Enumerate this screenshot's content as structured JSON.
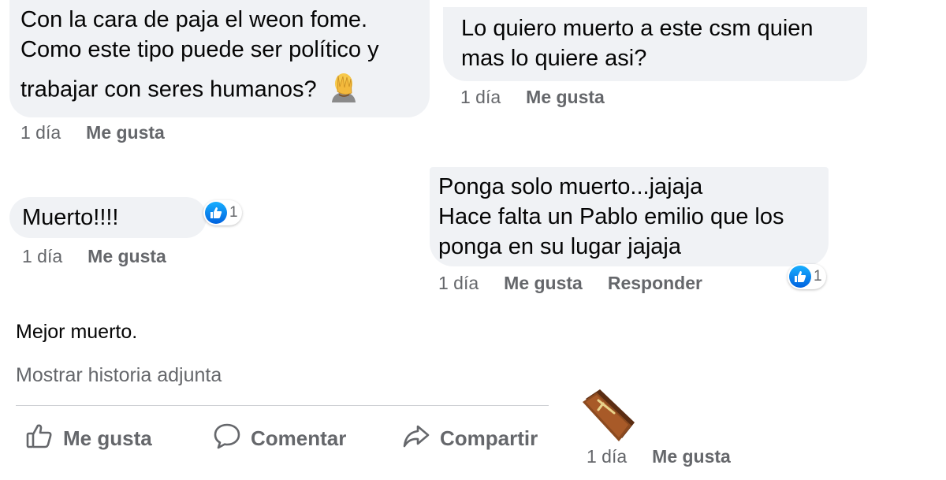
{
  "comments": [
    {
      "lines": [
        "Con la cara de paja el weon fome.",
        "Como este tipo puede ser político y",
        "trabajar con seres humanos?"
      ],
      "emoji": "face-palm-emoji",
      "time": "1 día",
      "like": "Me gusta"
    },
    {
      "lines": [
        "Lo quiero muerto a este csm  quien",
        "mas lo quiere asi?"
      ],
      "time": "1 día",
      "like": "Me gusta"
    },
    {
      "lines": [
        "Muerto!!!!"
      ],
      "time": "1 día",
      "like": "Me gusta",
      "reaction_count": "1"
    },
    {
      "lines": [
        "Ponga solo muerto...jajaja",
        "Hace falta un Pablo emilio que los",
        "ponga en su lugar jajaja"
      ],
      "time": "1 día",
      "like": "Me gusta",
      "reply": "Responder",
      "reaction_count": "1"
    },
    {
      "emoji": "coffin-emoji",
      "time": "1 día",
      "like": "Me gusta"
    }
  ],
  "post": {
    "text": "Mejor muerto.",
    "story_link": "Mostrar historia adjunta",
    "actions": {
      "like": "Me gusta",
      "comment": "Comentar",
      "share": "Compartir"
    }
  },
  "colors": {
    "bubble": "#f0f2f5",
    "meta_text": "#65676b",
    "like_blue": "#0866ff"
  }
}
